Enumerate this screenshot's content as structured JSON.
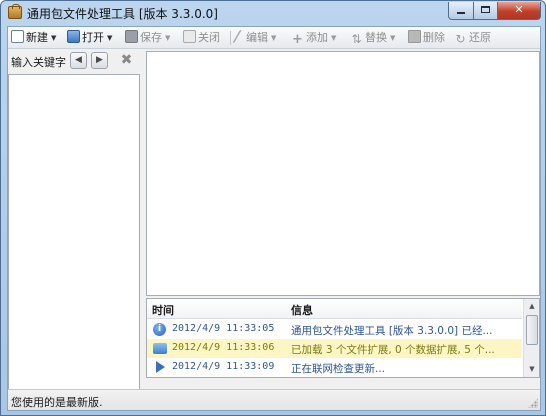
{
  "window": {
    "title": "通用包文件处理工具 [版本 3.3.0.0]",
    "close_label": "✕"
  },
  "toolbar": {
    "new_label": "新建",
    "open_label": "打开",
    "save_label": "保存",
    "close_label": "关闭",
    "edit_label": "编辑",
    "add_label": "添加",
    "replace_label": "替换",
    "delete_label": "删除",
    "restore_label": "还原"
  },
  "search": {
    "label": "输入关键字"
  },
  "log": {
    "columns": {
      "time": "时间",
      "info": "信息"
    },
    "rows": [
      {
        "type": "info",
        "time": "2012/4/9 11:33:05",
        "message": "通用包文件处理工具 [版本 3.3.0.0] 已经..."
      },
      {
        "type": "warn",
        "time": "2012/4/9 11:33:06",
        "message": "已加载 3 个文件扩展, 0 个数据扩展, 5 个..."
      },
      {
        "type": "progress",
        "time": "2012/4/9 11:33:09",
        "message": "正在联网检查更新..."
      }
    ]
  },
  "status": {
    "text": "您使用的是最新版."
  },
  "colors": {
    "title_bar": "#bcd5ee",
    "close_button": "#c0402b",
    "log_text": "#2e5597",
    "warn_row_bg": "#fbf6c4"
  },
  "icons": {
    "toolbar": [
      "new-file-icon",
      "open-folder-icon",
      "save-icon",
      "close-file-icon",
      "edit-icon",
      "add-icon",
      "replace-icon",
      "delete-icon",
      "restore-icon"
    ],
    "log": [
      "info-icon",
      "message-icon",
      "play-icon"
    ]
  }
}
